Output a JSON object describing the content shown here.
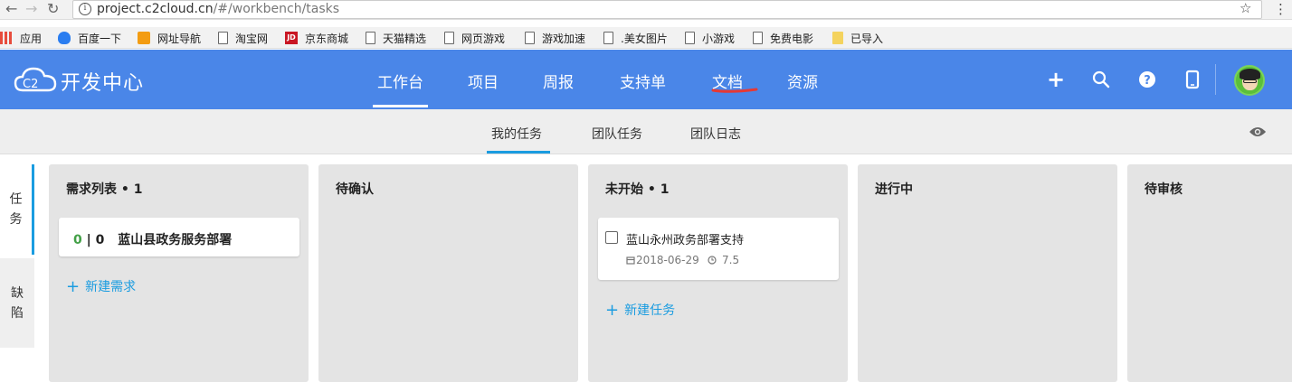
{
  "browser": {
    "url_host": "project.c2cloud.cn",
    "url_path": "/#/workbench/tasks"
  },
  "bookmarks": [
    {
      "label": "应用",
      "icon": "apps-icon"
    },
    {
      "label": "百度一下",
      "icon": "baidu-icon"
    },
    {
      "label": "网址导航",
      "icon": "hao123-icon"
    },
    {
      "label": "淘宝网",
      "icon": "page-icon"
    },
    {
      "label": "京东商城",
      "icon": "jd-icon"
    },
    {
      "label": "天猫精选",
      "icon": "page-icon"
    },
    {
      "label": "网页游戏",
      "icon": "page-icon"
    },
    {
      "label": "游戏加速",
      "icon": "page-icon"
    },
    {
      "label": ".美女图片",
      "icon": "page-icon"
    },
    {
      "label": "小游戏",
      "icon": "page-icon"
    },
    {
      "label": "免费电影",
      "icon": "page-icon"
    },
    {
      "label": "已导入",
      "icon": "folder-icon"
    }
  ],
  "app": {
    "logo_text": "开发中心",
    "logo_badge": "C2",
    "nav": [
      "工作台",
      "项目",
      "周报",
      "支持单",
      "文档",
      "资源"
    ],
    "active_nav": "工作台",
    "colors": {
      "primary": "#4a86e8",
      "accent": "#1a9ce0",
      "annotation": "#e53935"
    }
  },
  "subtabs": [
    "我的任务",
    "团队任务",
    "团队日志"
  ],
  "active_subtab": "我的任务",
  "side_tabs": [
    {
      "chars": [
        "任",
        "务"
      ],
      "active": true
    },
    {
      "chars": [
        "缺",
        "陷"
      ],
      "active": false
    }
  ],
  "columns": [
    {
      "title": "需求列表 • 1"
    },
    {
      "title": "待确认"
    },
    {
      "title": "未开始 • 1"
    },
    {
      "title": "进行中"
    },
    {
      "title": "待审核"
    }
  ],
  "requirement_card": {
    "done": "0",
    "sep": "|",
    "total": "0",
    "name": "蓝山县政务服务部署"
  },
  "add_requirement": "新建需求",
  "task_card": {
    "name": "蓝山永州政务部署支持",
    "date": "2018-06-29",
    "hours": "7.5"
  },
  "add_task": "新建任务",
  "plus_symbol": "+"
}
